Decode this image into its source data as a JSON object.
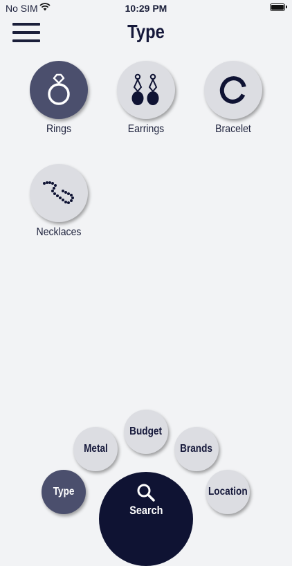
{
  "status": {
    "carrier": "No SIM",
    "time": "10:29 PM"
  },
  "header": {
    "title": "Type"
  },
  "types": [
    {
      "label": "Rings",
      "selected": true
    },
    {
      "label": "Earrings",
      "selected": false
    },
    {
      "label": "Bracelet",
      "selected": false
    },
    {
      "label": "Necklaces",
      "selected": false
    }
  ],
  "filters": {
    "type": "Type",
    "metal": "Metal",
    "budget": "Budget",
    "brands": "Brands",
    "location": "Location"
  },
  "search": {
    "label": "Search"
  },
  "colors": {
    "accent": "#4b4f6d",
    "primary": "#0f1333",
    "background": "#f2f3f5",
    "bubble": "#dcdde2"
  }
}
